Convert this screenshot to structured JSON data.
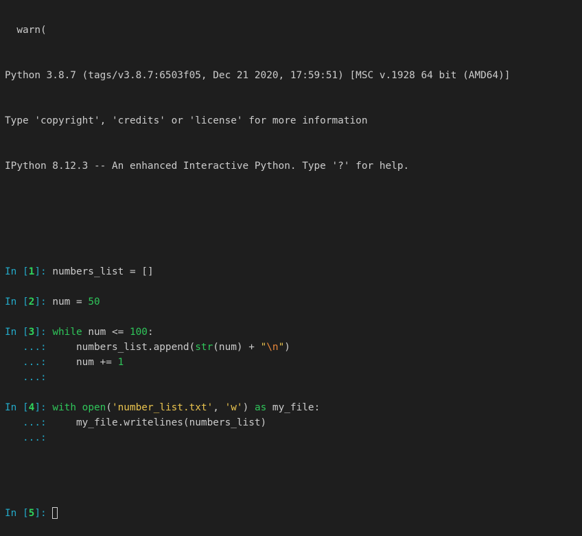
{
  "header": {
    "partial_line": "  warn(",
    "python_version": "Python 3.8.7 (tags/v3.8.7:6503f05, Dec 21 2020, 17:59:51) [MSC v.1928 64 bit (AMD64)]",
    "info_line": "Type 'copyright', 'credits' or 'license' for more information",
    "ipython_line": "IPython 8.12.3 -- An enhanced Interactive Python. Type '?' for help."
  },
  "prompt": {
    "in_word": "In [",
    "close": "]: ",
    "continuation": "   ...: "
  },
  "cells": [
    {
      "number": "1",
      "lines": [
        [
          {
            "t": "plain",
            "v": "numbers_list = []"
          }
        ]
      ],
      "trailing_continuations": 0
    },
    {
      "number": "2",
      "lines": [
        [
          {
            "t": "plain",
            "v": "num = "
          },
          {
            "t": "num",
            "v": "50"
          }
        ]
      ],
      "trailing_continuations": 0
    },
    {
      "number": "3",
      "lines": [
        [
          {
            "t": "kw",
            "v": "while"
          },
          {
            "t": "plain",
            "v": " num <= "
          },
          {
            "t": "num",
            "v": "100"
          },
          {
            "t": "plain",
            "v": ":"
          }
        ],
        [
          {
            "t": "plain",
            "v": "    numbers_list.append("
          },
          {
            "t": "builtin",
            "v": "str"
          },
          {
            "t": "plain",
            "v": "(num) + "
          },
          {
            "t": "str",
            "v": "\""
          },
          {
            "t": "esc",
            "v": "\\n"
          },
          {
            "t": "str",
            "v": "\""
          },
          {
            "t": "plain",
            "v": ")"
          }
        ],
        [
          {
            "t": "plain",
            "v": "    num += "
          },
          {
            "t": "num",
            "v": "1"
          }
        ]
      ],
      "trailing_continuations": 1
    },
    {
      "number": "4",
      "lines": [
        [
          {
            "t": "kw",
            "v": "with"
          },
          {
            "t": "plain",
            "v": " "
          },
          {
            "t": "builtin",
            "v": "open"
          },
          {
            "t": "plain",
            "v": "("
          },
          {
            "t": "str",
            "v": "'number_list.txt'"
          },
          {
            "t": "plain",
            "v": ", "
          },
          {
            "t": "str",
            "v": "'w'"
          },
          {
            "t": "plain",
            "v": ") "
          },
          {
            "t": "kw",
            "v": "as"
          },
          {
            "t": "plain",
            "v": " my_file:"
          }
        ],
        [
          {
            "t": "plain",
            "v": "    my_file.writelines(numbers_list)"
          }
        ]
      ],
      "trailing_continuations": 1
    }
  ],
  "active_prompt": {
    "number": "5",
    "input_value": ""
  },
  "colors": {
    "background": "#1e1e1e",
    "text": "#cccccc",
    "prompt_in": "#23a9c8",
    "prompt_number": "#2fd35c",
    "keyword": "#2fc65a",
    "string": "#e9c34e",
    "escape": "#e8873a"
  }
}
